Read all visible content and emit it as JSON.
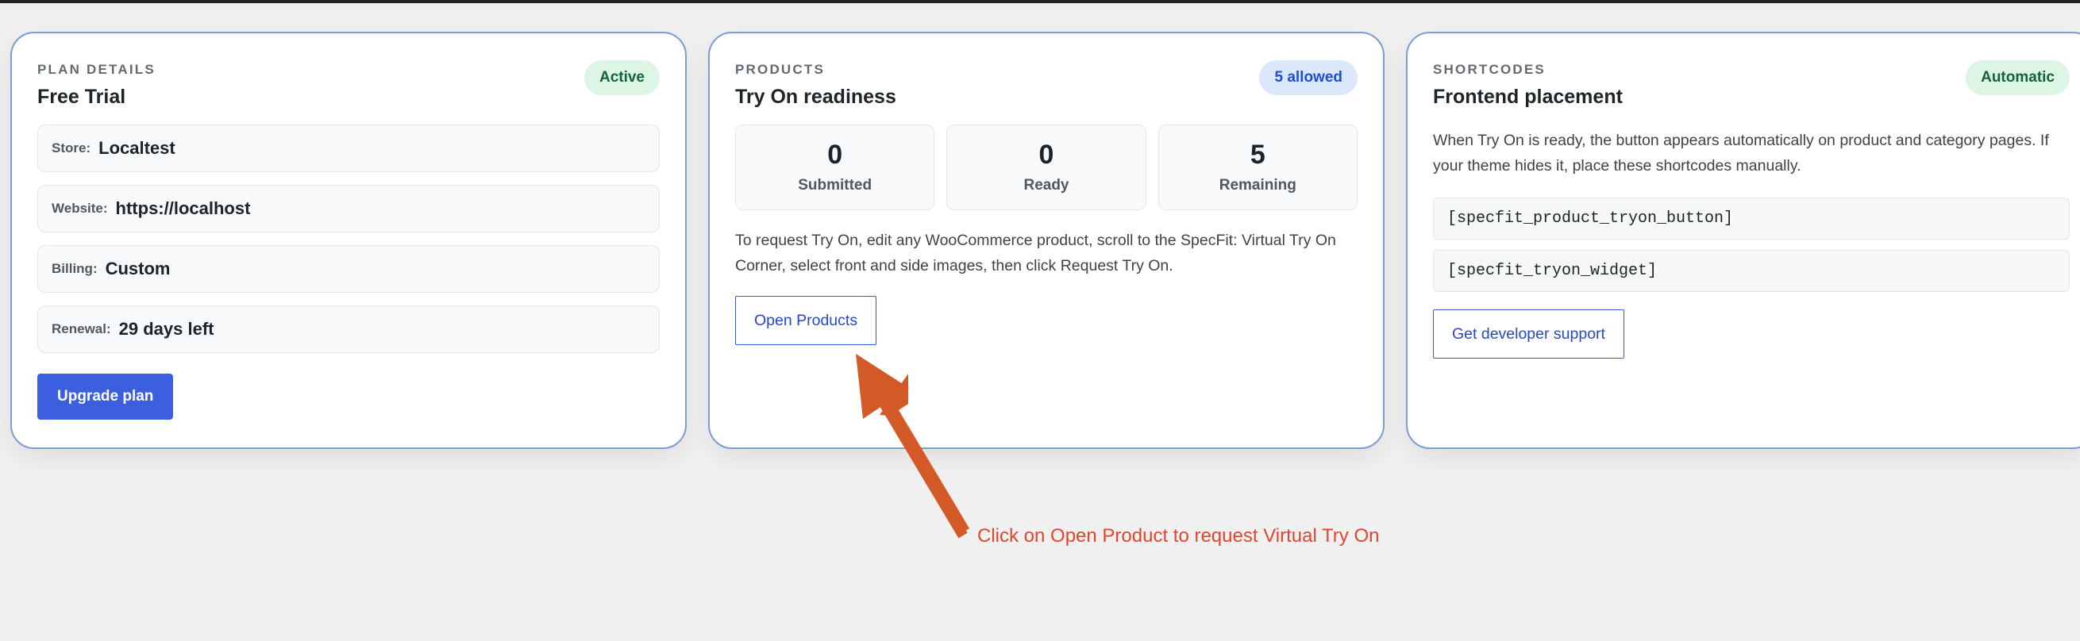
{
  "cards": {
    "plan": {
      "eyebrow": "PLAN DETAILS",
      "title": "Free Trial",
      "badge": "Active",
      "rows": [
        {
          "label": "Store:",
          "value": "Localtest"
        },
        {
          "label": "Website:",
          "value": "https://localhost"
        },
        {
          "label": "Billing:",
          "value": "Custom"
        },
        {
          "label": "Renewal:",
          "value": "29 days left"
        }
      ],
      "button": "Upgrade plan"
    },
    "products": {
      "eyebrow": "PRODUCTS",
      "title": "Try On readiness",
      "badge": "5 allowed",
      "stats": [
        {
          "value": "0",
          "label": "Submitted"
        },
        {
          "value": "0",
          "label": "Ready"
        },
        {
          "value": "5",
          "label": "Remaining"
        }
      ],
      "description": "To request Try On, edit any WooCommerce product, scroll to the SpecFit: Virtual Try On Corner, select front and side images, then click Request Try On.",
      "button": "Open Products"
    },
    "shortcodes": {
      "eyebrow": "SHORTCODES",
      "title": "Frontend placement",
      "badge": "Automatic",
      "description": "When Try On is ready, the button appears automatically on product and category pages. If your theme hides it, place these shortcodes manually.",
      "codes": [
        "[specfit_product_tryon_button]",
        "[specfit_tryon_widget]"
      ],
      "button": "Get developer support"
    }
  },
  "annotation": {
    "text": "Click on Open Product to request Virtual Try On",
    "color": "#e0452f",
    "arrow_color": "#d35a27"
  }
}
